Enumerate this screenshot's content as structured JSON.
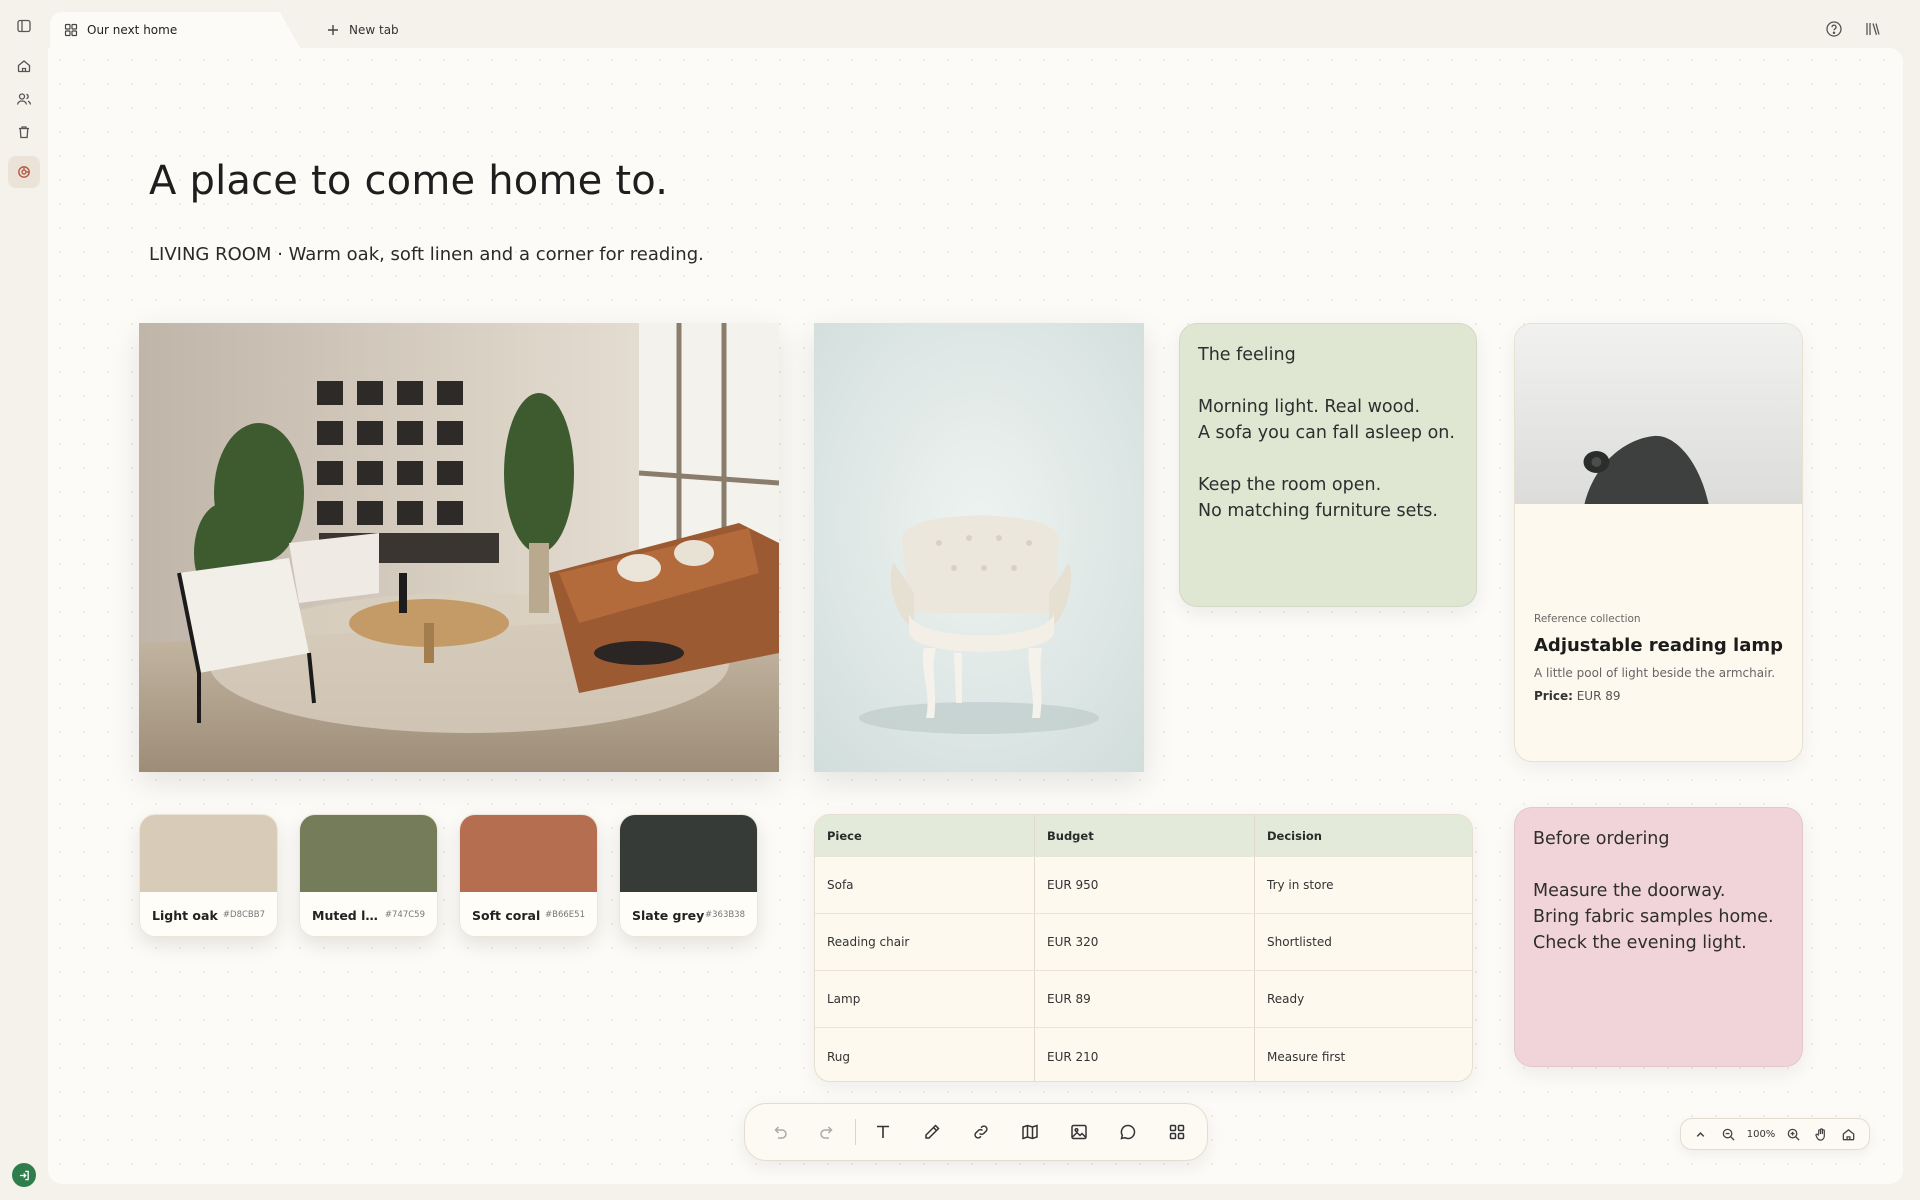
{
  "tabs": [
    {
      "label": "Our next home",
      "icon": "board-icon"
    },
    {
      "label": "New tab",
      "icon": "plus-icon"
    }
  ],
  "page": {
    "title": "A place to come home to.",
    "subtitle": "LIVING ROOM · Warm oak, soft linen and a corner for reading."
  },
  "note_feeling": {
    "heading": "The feeling",
    "line1": "Morning light. Real wood.",
    "line2": "A sofa you can fall asleep on.",
    "line3": "Keep the room open.",
    "line4": "No matching furniture sets.",
    "color": "#dfe6d2"
  },
  "product": {
    "kicker": "Reference collection",
    "title": "Adjustable reading lamp",
    "description": "A little pool of light beside the armchair.",
    "price_label": "Price:",
    "price_value": "EUR 89"
  },
  "swatches": [
    {
      "name": "Light oak",
      "hex": "#D8CBB7",
      "color": "#d8cbb7"
    },
    {
      "name": "Muted leaf",
      "hex": "#747C59",
      "color": "#747c59"
    },
    {
      "name": "Soft coral",
      "hex": "#B66E51",
      "color": "#b66e51"
    },
    {
      "name": "Slate grey",
      "hex": "#363B38",
      "color": "#363b38"
    }
  ],
  "table": {
    "headers": [
      "Piece",
      "Budget",
      "Decision"
    ],
    "rows": [
      [
        "Sofa",
        "EUR 950",
        "Try in store"
      ],
      [
        "Reading chair",
        "EUR 320",
        "Shortlisted"
      ],
      [
        "Lamp",
        "EUR 89",
        "Ready"
      ],
      [
        "Rug",
        "EUR 210",
        "Measure first"
      ]
    ]
  },
  "note_order": {
    "heading": "Before ordering",
    "line1": "Measure the doorway.",
    "line2": "Bring fabric samples home.",
    "line3": "Check the evening light.",
    "color": "#f1d4da"
  },
  "toolbar": {
    "tools": [
      "undo-icon",
      "redo-icon",
      "text-icon",
      "pen-icon",
      "link-icon",
      "map-icon",
      "image-icon",
      "comment-icon",
      "apps-grid-icon"
    ]
  },
  "zoom": {
    "level": "100%"
  },
  "colors": {
    "accent": "#b35a45",
    "canvas": "#fdfbf7",
    "status_green": "#2f7d4a"
  }
}
